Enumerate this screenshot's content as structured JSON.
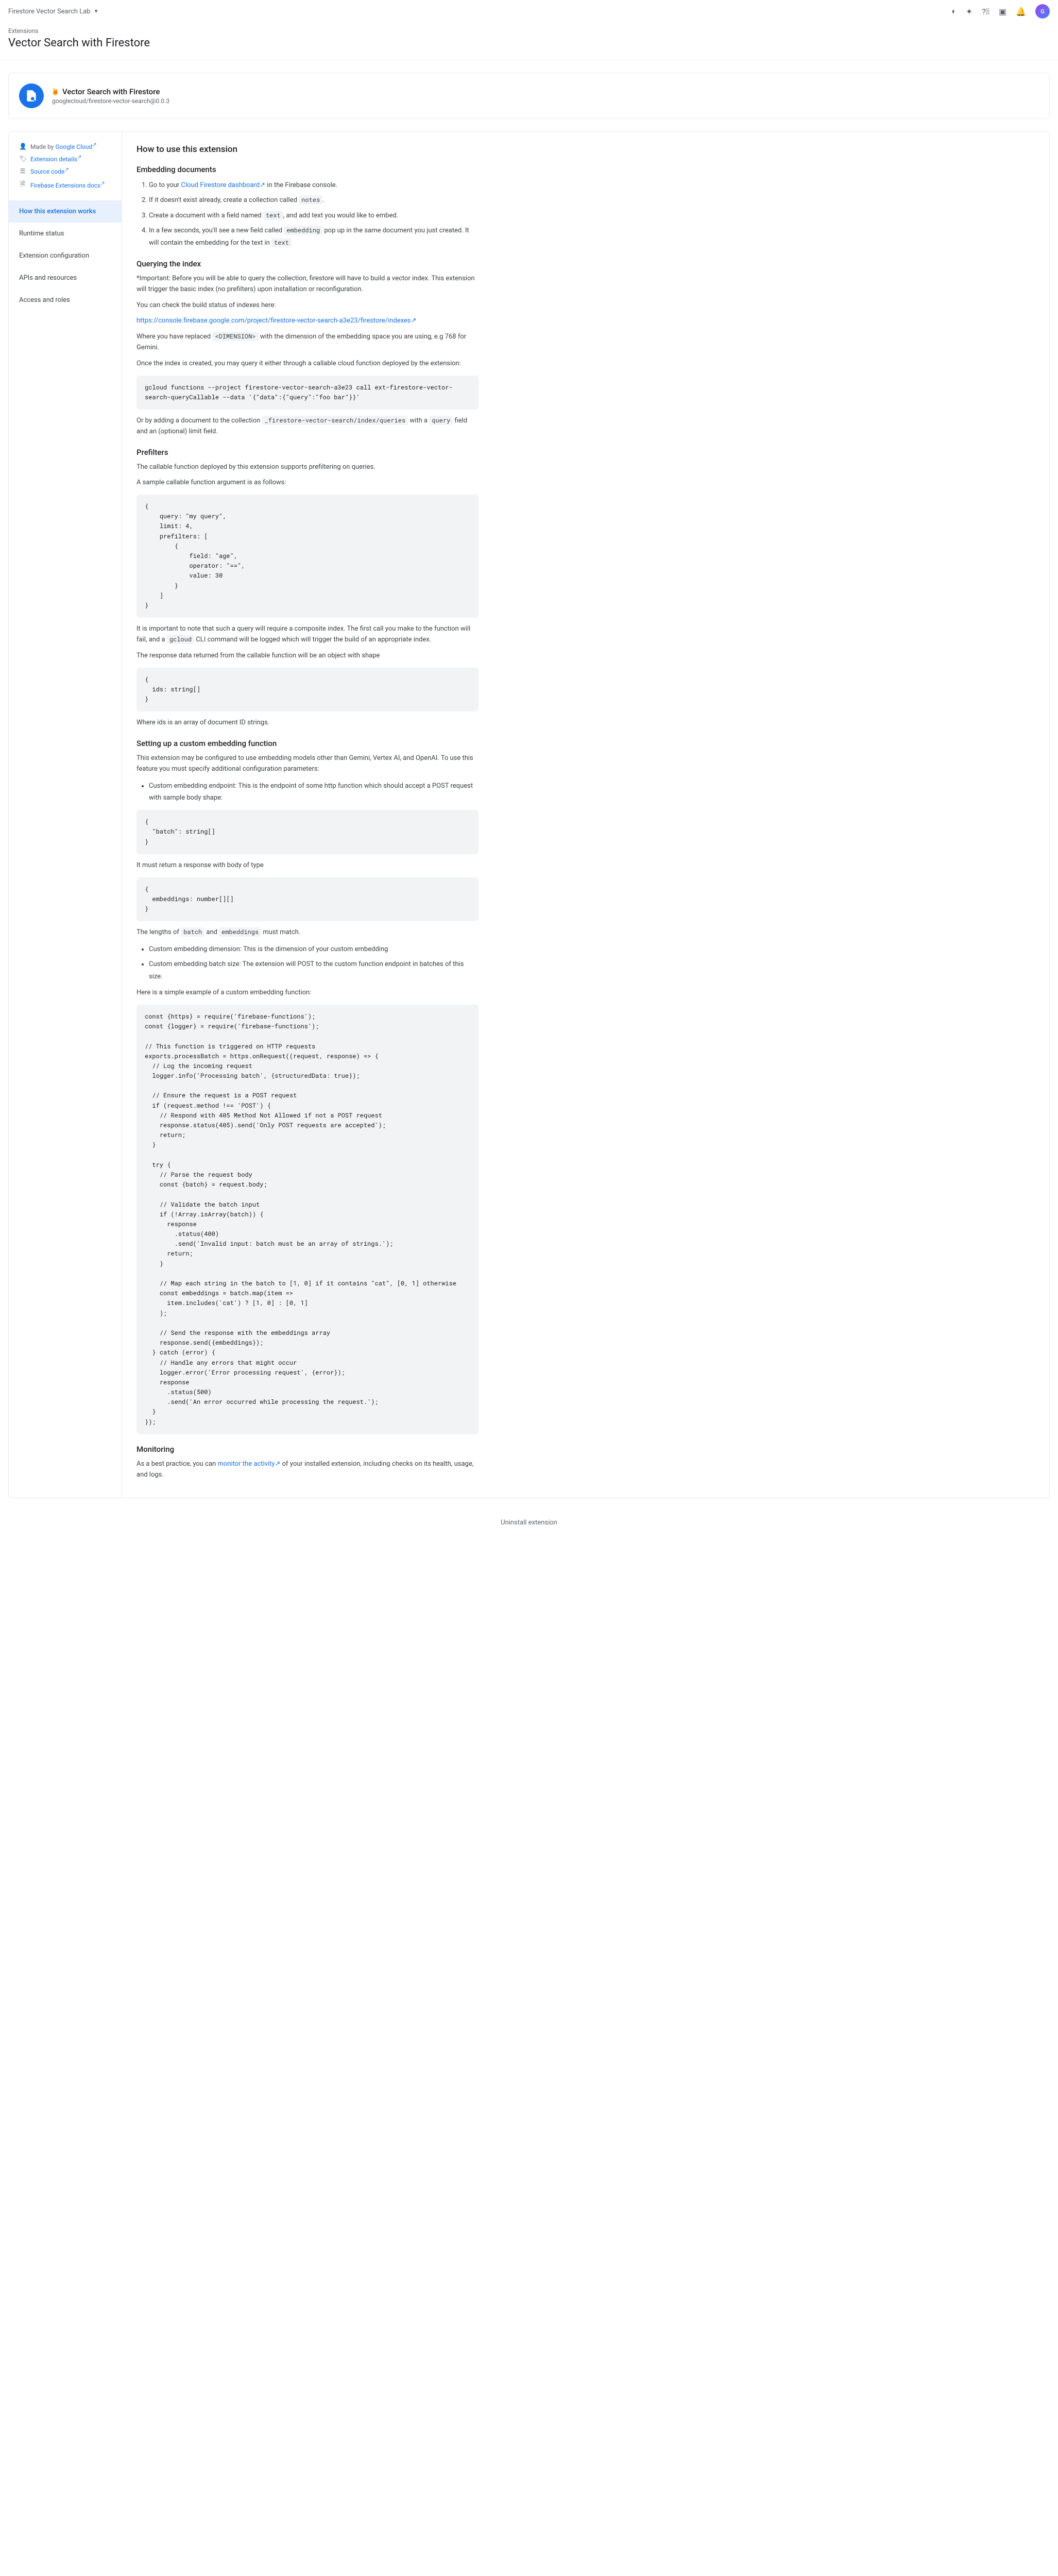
{
  "topbar": {
    "project": "Firestore Vector Search Lab",
    "avatar_initial": "G"
  },
  "header": {
    "breadcrumb": "Extensions",
    "title": "Vector Search with Firestore"
  },
  "ext_card": {
    "name": "Vector Search with Firestore",
    "id": "googlecloud/firestore-vector-search@0.0.3"
  },
  "sidebar": {
    "made_by": "Made by",
    "made_by_link": "Google Cloud",
    "details": "Extension details",
    "source": "Source code",
    "docs": "Firebase Extensions docs",
    "nav": [
      "How this extension works",
      "Runtime status",
      "Extension configuration",
      "APIs and resources",
      "Access and roles"
    ]
  },
  "content": {
    "h_how": "How to use this extension",
    "h_embed": "Embedding documents",
    "step1a": "Go to your ",
    "step1_link": "Cloud Firestore dashboard",
    "step1b": " in the Firebase console.",
    "step2a": "If it doesn't exist already, create a collection called ",
    "step2_code": "notes",
    "step2b": ".",
    "step3a": "Create a document with a field named ",
    "step3_code1": "text",
    "step3b": ", and add text you would like to embed.",
    "step4a": "In a few seconds, you'll see a new field called ",
    "step4_code1": "embedding",
    "step4b": " pop up in the same document you just created. It will contain the embedding for the text in ",
    "step4_code2": "text",
    "h_query": "Querying the index",
    "p_important": "*Important: Before you will be able to query the collection, firestore will have to build a vector index. This extension will trigger the basic index (no prefilters) upon installation or reconfiguration.",
    "p_check": "You can check the build status of indexes here:",
    "link_console": "https://console.firebase.google.com/project/firestore-vector-search-a3e23/firestore/indexes",
    "p_replaced_a": "Where you have replaced ",
    "p_replaced_code": "<DIMENSION>",
    "p_replaced_b": " with the dimension of the embedding space you are using, e.g 768 for Gemini.",
    "p_once": "Once the index is created, you may query it either through a callable cloud function deployed by the extension:",
    "code_gcloud": "gcloud functions --project firestore-vector-search-a3e23 call ext-firestore-vector-search-queryCallable --data '{\"data\":{\"query\":\"foo bar\"}}'",
    "p_orby_a": "Or by adding a document to the collection ",
    "p_orby_code1": "_firestore-vector-search/index/queries",
    "p_orby_b": " with a ",
    "p_orby_code2": "query",
    "p_orby_c": " field and an (optional) limit field.",
    "h_prefilters": "Prefilters",
    "p_callable": "The callable function deployed by this extension supports prefiltering on queries.",
    "p_sample": "A sample callable function argument is as follows:",
    "code_prefilter": "{\n    query: \"my query\",\n    limit: 4,\n    prefilters: [\n        {\n            field: \"age\",\n            operator: \"==\",\n            value: 30\n        }\n    ]\n}",
    "p_composite_a": "It is important to note that such a query will require a composite index. The first call you make to the function will fail, and a ",
    "p_composite_code": "gcloud",
    "p_composite_b": " CLI command will be logged which will trigger the build of an appropriate index.",
    "p_response": "The response data returned from the callable function will be an object with shape",
    "code_ids": "{\n  ids: string[]\n}",
    "p_ids": "Where ids is an array of document ID strings.",
    "h_custom": "Setting up a custom embedding function",
    "p_custom1": "This extension may be configured to use embedding models other than Gemini, Vertex AI, and OpenAI. To use this feature you must specify additional configuration parameters:",
    "li_custom1": "Custom embedding endpoint: This is the endpoint of some http function which should accept a POST request with sample body shape:",
    "code_batch": "{\n  \"batch\": string[]\n}",
    "p_must": "It must return a response with body of type",
    "code_embeddings": "{\n  embeddings: number[][]\n}",
    "p_lengths_a": "The lengths of ",
    "p_lengths_code1": "batch",
    "p_lengths_b": " and ",
    "p_lengths_code2": "embeddings",
    "p_lengths_c": " must match.",
    "li_custom2": "Custom embedding dimension: This is the dimension of your custom embedding",
    "li_custom3": "Custom embedding batch size: The extension will POST to the custom function endpoint in batches of this size.",
    "p_example": "Here is a simple example of a custom embedding function:",
    "code_example": "const {https} = require('firebase-functions');\nconst {logger} = require('firebase-functions');\n\n// This function is triggered on HTTP requests\nexports.processBatch = https.onRequest((request, response) => {\n  // Log the incoming request\n  logger.info('Processing batch', {structuredData: true});\n\n  // Ensure the request is a POST request\n  if (request.method !== 'POST') {\n    // Respond with 405 Method Not Allowed if not a POST request\n    response.status(405).send('Only POST requests are accepted');\n    return;\n  }\n\n  try {\n    // Parse the request body\n    const {batch} = request.body;\n\n    // Validate the batch input\n    if (!Array.isArray(batch)) {\n      response\n        .status(400)\n        .send('Invalid input: batch must be an array of strings.');\n      return;\n    }\n\n    // Map each string in the batch to [1, 0] if it contains \"cat\", [0, 1] otherwise\n    const embeddings = batch.map(item =>\n      item.includes('cat') ? [1, 0] : [0, 1]\n    );\n\n    // Send the response with the embeddings array\n    response.send({embeddings});\n  } catch (error) {\n    // Handle any errors that might occur\n    logger.error('Error processing request', {error});\n    response\n      .status(500)\n      .send('An error occurred while processing the request.');\n  }\n});",
    "h_monitoring": "Monitoring",
    "p_monitor_a": "As a best practice, you can ",
    "p_monitor_link": "monitor the activity",
    "p_monitor_b": " of your installed extension, including checks on its health, usage, and logs."
  },
  "uninstall": "Uninstall extension"
}
